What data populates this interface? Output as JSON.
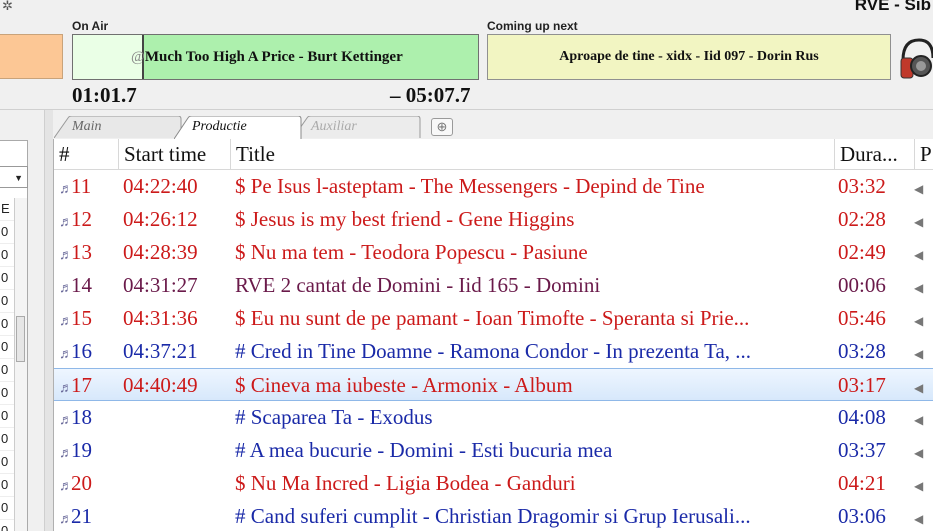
{
  "app": {
    "station_label": "RVE - Sib"
  },
  "on_air": {
    "label": "On Air",
    "prefix": "@",
    "track": "Much Too High A Price - Burt Kettinger",
    "elapsed": "01:01.7",
    "remaining": "– 05:07.7",
    "progress_fraction": 0.17,
    "color": "#adf0ad"
  },
  "coming_up": {
    "label": "Coming up next",
    "track": "Aproape de tine - xidx - Iid 097 - Dorin Rus",
    "color": "#f2f5c2"
  },
  "tabs": [
    {
      "label": "Main",
      "active": false
    },
    {
      "label": "Productie",
      "active": true
    },
    {
      "label": "Auxiliar",
      "active": false
    }
  ],
  "add_tab_icon": "plus-icon",
  "table": {
    "headers": [
      "#",
      "Start time",
      "Title",
      "Dura...",
      "P"
    ],
    "rows": [
      {
        "num": "11",
        "start": "04:22:40",
        "title": "$ Pe Isus l-asteptam - The Messengers - Depind de Tine",
        "duration": "03:32",
        "color": "red",
        "selected": false
      },
      {
        "num": "12",
        "start": "04:26:12",
        "title": "$ Jesus is my best friend - Gene Higgins",
        "duration": "02:28",
        "color": "red",
        "selected": false
      },
      {
        "num": "13",
        "start": "04:28:39",
        "title": "$ Nu ma tem - Teodora Popescu - Pasiune",
        "duration": "02:49",
        "color": "red",
        "selected": false
      },
      {
        "num": "14",
        "start": "04:31:27",
        "title": "RVE 2 cantat de Domini - Iid 165 - Domini",
        "duration": "00:06",
        "color": "purple",
        "selected": false
      },
      {
        "num": "15",
        "start": "04:31:36",
        "title": "$  Eu nu sunt de pe pamant - Ioan Timofte - Speranta si Prie...",
        "duration": "05:46",
        "color": "red",
        "selected": false
      },
      {
        "num": "16",
        "start": "04:37:21",
        "title": "# Cred in Tine Doamne - Ramona Condor - In prezenta Ta, ...",
        "duration": "03:28",
        "color": "blue",
        "selected": false
      },
      {
        "num": "17",
        "start": "04:40:49",
        "title": "$ Cineva ma iubeste - Armonix - Album",
        "duration": "03:17",
        "color": "red",
        "selected": true
      },
      {
        "num": "18",
        "start": "",
        "title": "# Scaparea Ta - Exodus",
        "duration": "04:08",
        "color": "blue",
        "selected": false
      },
      {
        "num": "19",
        "start": "",
        "title": "# A mea bucurie - Domini - Esti bucuria mea",
        "duration": "03:37",
        "color": "blue",
        "selected": false
      },
      {
        "num": "20",
        "start": "",
        "title": "$ Nu Ma Incred - Ligia Bodea - Ganduri",
        "duration": "04:21",
        "color": "red",
        "selected": false
      },
      {
        "num": "21",
        "start": "",
        "title": "# Cand suferi cumplit - Christian Dragomir si Grup Ierusali...",
        "duration": "03:06",
        "color": "blue",
        "selected": false
      }
    ]
  },
  "left_list": [
    "E",
    "0",
    "0",
    "0",
    "0",
    "0",
    "0",
    "0",
    "0",
    "0",
    "0",
    "0",
    "0",
    "0",
    "0"
  ],
  "colors": {
    "red": "#cc1a1a",
    "purple": "#6a1a4a",
    "blue": "#1a2aa8",
    "selection": "#d7e8fb"
  }
}
